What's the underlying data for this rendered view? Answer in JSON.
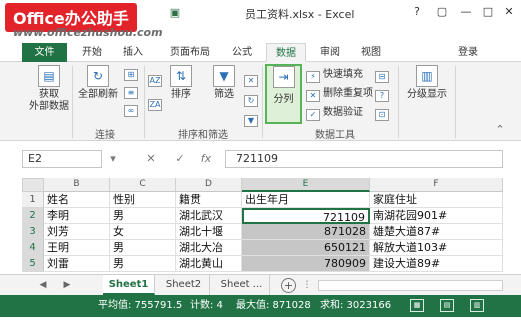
{
  "brand": {
    "logo": "Office办公助手",
    "url": "www.officezhushou.com"
  },
  "window": {
    "title": "员工资料.xlsx - Excel",
    "help": "?",
    "restore": "▢",
    "minimize": "—",
    "maximize": "□",
    "close": "✕"
  },
  "ribbon_tabs": [
    "文件",
    "开始",
    "插入",
    "页面布局",
    "公式",
    "数据",
    "审阅",
    "视图"
  ],
  "active_tab": "数据",
  "login": "登录",
  "ribbon": {
    "get_external_data": "获取\n外部数据",
    "refresh_all": "全部刷新",
    "sort": "排序",
    "filter": "筛选",
    "text_to_columns": "分列",
    "flash_fill": "快速填充",
    "remove_duplicates": "删除重复项",
    "data_validation": "数据验证",
    "outline": "分级显示",
    "groups": {
      "connections": "连接",
      "sort_filter": "排序和筛选",
      "data_tools": "数据工具"
    }
  },
  "formula_bar": {
    "name_box": "E2",
    "cancel": "✕",
    "enter": "✓",
    "fx": "fx",
    "value": "721109"
  },
  "columns": [
    "B",
    "C",
    "D",
    "E",
    "F"
  ],
  "selected_column": "E",
  "rows": [
    {
      "num": "1",
      "cells": [
        "姓名",
        "性别",
        "籍贯",
        "出生年月",
        "家庭住址"
      ]
    },
    {
      "num": "2",
      "cells": [
        "李明",
        "男",
        "湖北武汉",
        "721109",
        "南湖花园901#"
      ]
    },
    {
      "num": "3",
      "cells": [
        "刘芳",
        "女",
        "湖北十堰",
        "871028",
        "雄楚大道87#"
      ]
    },
    {
      "num": "4",
      "cells": [
        "王明",
        "男",
        "湖北大冶",
        "650121",
        "解放大道103#"
      ]
    },
    {
      "num": "5",
      "cells": [
        "刘雷",
        "男",
        "湖北黄山",
        "780909",
        "建设大道89#"
      ]
    }
  ],
  "sheets": [
    "Sheet1",
    "Sheet2",
    "Sheet ..."
  ],
  "active_sheet": "Sheet1",
  "status": {
    "average": "平均值: 755791.5",
    "count": "计数: 4",
    "max": "最大值: 871028",
    "sum": "求和: 3023166"
  }
}
